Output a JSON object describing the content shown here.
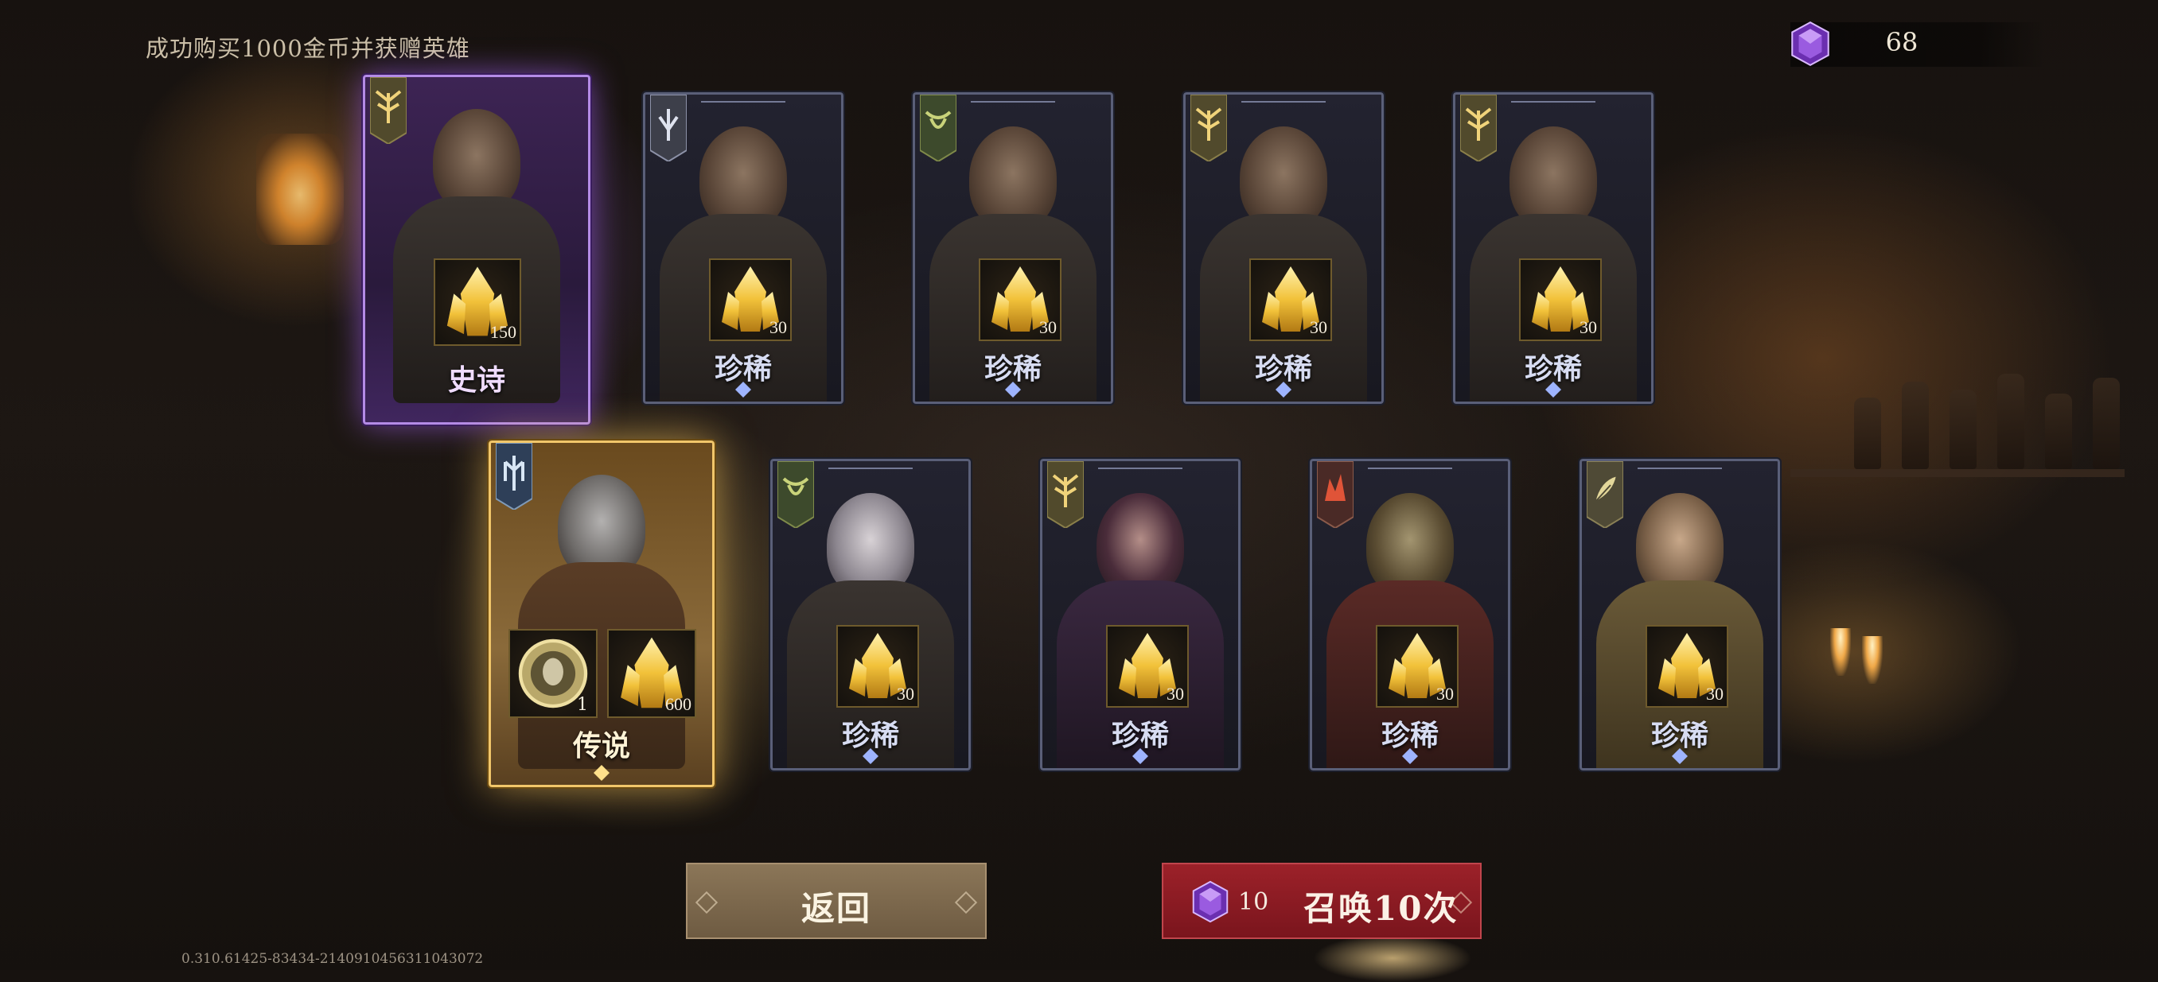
{
  "header": {
    "notice": "成功购买1000金币并获赠英雄",
    "gem_count": "68"
  },
  "footer": {
    "version": "0.310.61425-83434-2140910456311043072"
  },
  "colors": {
    "epic": "#b48be6",
    "legendary": "#f1c66a",
    "rare": "#5a5f78",
    "summon_button": "#9c2129",
    "back_button": "#8b7658"
  },
  "cards": [
    {
      "rarity": "史诗",
      "shard_count": "150",
      "faction_icon": "gold-wings-emblem-icon"
    },
    {
      "rarity": "珍稀",
      "shard_count": "30",
      "faction_icon": "silver-crest-emblem-icon"
    },
    {
      "rarity": "珍稀",
      "shard_count": "30",
      "faction_icon": "green-bull-emblem-icon"
    },
    {
      "rarity": "珍稀",
      "shard_count": "30",
      "faction_icon": "gold-wings-emblem-icon"
    },
    {
      "rarity": "珍稀",
      "shard_count": "30",
      "faction_icon": "gold-wings-emblem-icon"
    },
    {
      "rarity": "传说",
      "token_count": "1",
      "shard_count": "600",
      "faction_icon": "blue-crest-emblem-icon"
    },
    {
      "rarity": "珍稀",
      "shard_count": "30",
      "faction_icon": "green-bull-emblem-icon"
    },
    {
      "rarity": "珍稀",
      "shard_count": "30",
      "faction_icon": "gold-wings-emblem-icon"
    },
    {
      "rarity": "珍稀",
      "shard_count": "30",
      "faction_icon": "red-flame-emblem-icon"
    },
    {
      "rarity": "珍稀",
      "shard_count": "30",
      "faction_icon": "gold-leaf-emblem-icon"
    }
  ],
  "buttons": {
    "back_label": "返回",
    "summon_cost": "10",
    "summon_label": "召唤10次"
  }
}
